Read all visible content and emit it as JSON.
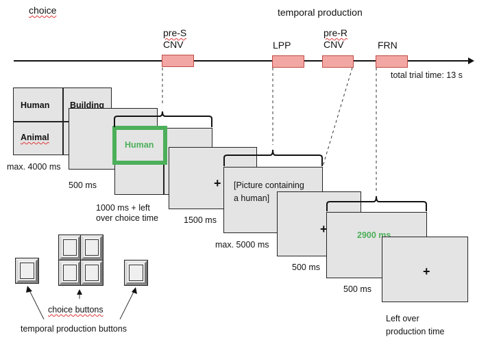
{
  "phases": {
    "choice_label": "choice",
    "temporal_label": "temporal production"
  },
  "timeline": {
    "total_label": "total trial time: 13 s",
    "erp_components": [
      {
        "line1": "pre-S",
        "line2": "CNV",
        "color": "#f2a7a4"
      },
      {
        "line1": "LPP",
        "line2": "",
        "color": "#f2a7a4"
      },
      {
        "line1": "pre-R",
        "line2": "CNV",
        "color": "#f2a7a4"
      },
      {
        "line1": "FRN",
        "line2": "",
        "color": "#f2a7a4"
      }
    ]
  },
  "screens": {
    "choice_grid": {
      "cells": [
        "Human",
        "Building",
        "Animal",
        ""
      ],
      "duration": "max. 4000 ms"
    },
    "blank_1": {
      "duration": "500 ms"
    },
    "selected": {
      "label": "Human",
      "highlight_color": "#4caf5a",
      "duration_line1": "1000 ms + left",
      "duration_line2": "over choice time"
    },
    "fixation_1": {
      "symbol": "+",
      "duration": "1500 ms"
    },
    "picture": {
      "line1": "[Picture containing",
      "line2": "a human]",
      "duration": "max. 5000 ms"
    },
    "fixation_2": {
      "symbol": "+",
      "duration": "500 ms"
    },
    "feedback": {
      "label": "2900 ms",
      "color": "#4caf5a",
      "duration": "500 ms"
    },
    "fixation_3": {
      "symbol": "+",
      "duration_line1": "Left over",
      "duration_line2": "production time"
    }
  },
  "buttons": {
    "choice_label": "choice buttons",
    "temporal_label": "temporal production buttons"
  }
}
